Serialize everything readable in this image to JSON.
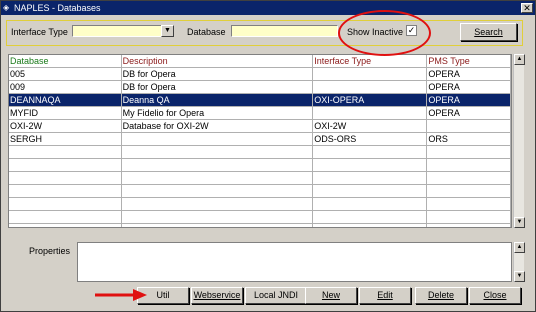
{
  "window": {
    "title": "NAPLES - Databases",
    "close_glyph": "✕"
  },
  "filter": {
    "interface_type_label": "Interface Type",
    "interface_type_value": "",
    "database_label": "Database",
    "database_value": "",
    "show_inactive_label": "Show Inactive",
    "show_inactive_checked": true,
    "show_inactive_glyph": "✓",
    "search_label": "Search"
  },
  "grid": {
    "columns": [
      "Database",
      "Description",
      "Interface Type",
      "PMS Type"
    ],
    "rows": [
      [
        "005",
        "DB for Opera",
        "",
        "OPERA"
      ],
      [
        "009",
        "DB for Opera",
        "",
        "OPERA"
      ],
      [
        "DEANNAQA",
        "Deanna QA",
        "OXI-OPERA",
        "OPERA"
      ],
      [
        "MYFID",
        "My Fidelio for Opera",
        "",
        "OPERA"
      ],
      [
        "OXI-2W",
        "Database for OXI-2W",
        "OXI-2W",
        ""
      ],
      [
        "SERGH",
        "",
        "ODS-ORS",
        "ORS"
      ],
      [
        "",
        "",
        "",
        ""
      ],
      [
        "",
        "",
        "",
        ""
      ],
      [
        "",
        "",
        "",
        ""
      ],
      [
        "",
        "",
        "",
        ""
      ],
      [
        "",
        "",
        "",
        ""
      ],
      [
        "",
        "",
        "",
        ""
      ],
      [
        "",
        "",
        "",
        ""
      ]
    ],
    "selected_index": 2
  },
  "properties_label": "Properties",
  "buttons": {
    "util": "Util",
    "webservice": "Webservice",
    "local_jndi": "Local JNDI",
    "new": "New",
    "edit": "Edit",
    "delete": "Delete",
    "close": "Close"
  },
  "colors": {
    "selection": "#0a246a",
    "header_text": "#8b1a1a",
    "database_header_text": "#1a7a1a",
    "annotation_red": "#e01010",
    "field_bg": "#ffffc8"
  }
}
